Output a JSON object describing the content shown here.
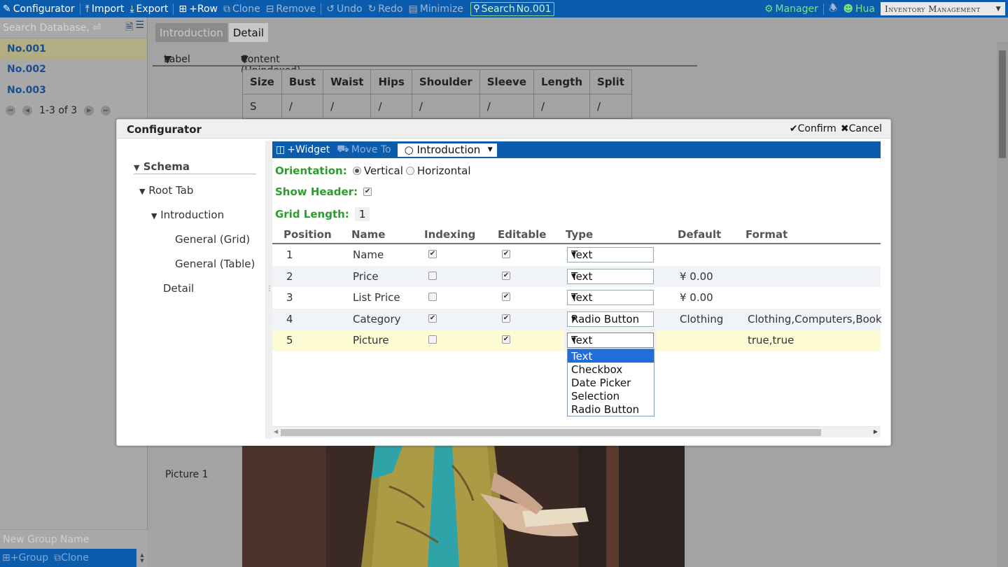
{
  "toolbar": {
    "configurator": "Configurator",
    "import": "Import",
    "export": "Export",
    "add_row": "+Row",
    "clone": "Clone",
    "remove": "Remove",
    "undo": "Undo",
    "redo": "Redo",
    "minimize": "Minimize",
    "search": "Search",
    "search_value": "No.001",
    "manager": "Manager",
    "user": "Hua",
    "database_select": "Inventory Management"
  },
  "sidebar": {
    "search_placeholder": "Search Database, ⏎",
    "items": [
      {
        "label": "No.001",
        "selected": true
      },
      {
        "label": "No.002",
        "selected": false
      },
      {
        "label": "No.003",
        "selected": false
      }
    ],
    "pager_text": "1-3 of 3",
    "group_name_placeholder": "New Group Name",
    "add_group": "+Group",
    "clone_group": "Clone"
  },
  "main": {
    "tabs": [
      {
        "label": "Introduction",
        "active": false
      },
      {
        "label": "Detail",
        "active": true
      }
    ],
    "detail_header": {
      "label": "Label",
      "content": "Content (Unindexed)"
    },
    "size_table": {
      "headers": [
        "Size",
        "Bust",
        "Waist",
        "Hips",
        "Shoulder",
        "Sleeve",
        "Length",
        "Split"
      ],
      "rows": [
        [
          "S",
          "/",
          "/",
          "/",
          "/",
          "/",
          "/",
          "/"
        ]
      ]
    },
    "picture_label": "Picture 1"
  },
  "dialog": {
    "title": "Configurator",
    "confirm": "Confirm",
    "cancel": "Cancel",
    "tree": {
      "schema": "Schema",
      "root_tab": "Root Tab",
      "introduction": "Introduction",
      "general_grid": "General (Grid)",
      "general_table": "General (Table)",
      "detail": "Detail"
    },
    "panel_toolbar": {
      "add_widget": "+Widget",
      "move_to": "Move To",
      "move_to_value": "○ Introduction"
    },
    "orientation": {
      "label": "Orientation:",
      "vertical": "Vertical",
      "horizontal": "Horizontal",
      "selected": "Vertical"
    },
    "show_header": {
      "label": "Show Header:",
      "checked": true
    },
    "grid_length": {
      "label": "Grid Length:",
      "value": "1"
    },
    "columns": [
      "Position",
      "Name",
      "Indexing",
      "Editable",
      "Type",
      "Default",
      "Format"
    ],
    "rows": [
      {
        "position": "1",
        "name": "Name",
        "indexing": true,
        "editable": true,
        "type": "Text",
        "default": "",
        "format": ""
      },
      {
        "position": "2",
        "name": "Price",
        "indexing": false,
        "editable": true,
        "type": "Text",
        "default": "¥ 0.00",
        "format": ""
      },
      {
        "position": "3",
        "name": "List Price",
        "indexing": false,
        "editable": true,
        "type": "Text",
        "default": "¥ 0.00",
        "format": ""
      },
      {
        "position": "4",
        "name": "Category",
        "indexing": true,
        "editable": true,
        "type": "Radio Button",
        "default": "Clothing",
        "format": "Clothing,Computers,Book"
      },
      {
        "position": "5",
        "name": "Picture",
        "indexing": false,
        "editable": true,
        "type": "Text",
        "default": "",
        "format": "true,true"
      }
    ],
    "type_options": [
      "Text",
      "Checkbox",
      "Date Picker",
      "Selection",
      "Radio Button"
    ],
    "type_selected": "Text"
  },
  "colors": {
    "toolbar_blue": "#0b5cad",
    "green_label": "#2c9d2c",
    "selected_option": "#1e6fd9",
    "highlight_row": "#fdfbd3"
  }
}
